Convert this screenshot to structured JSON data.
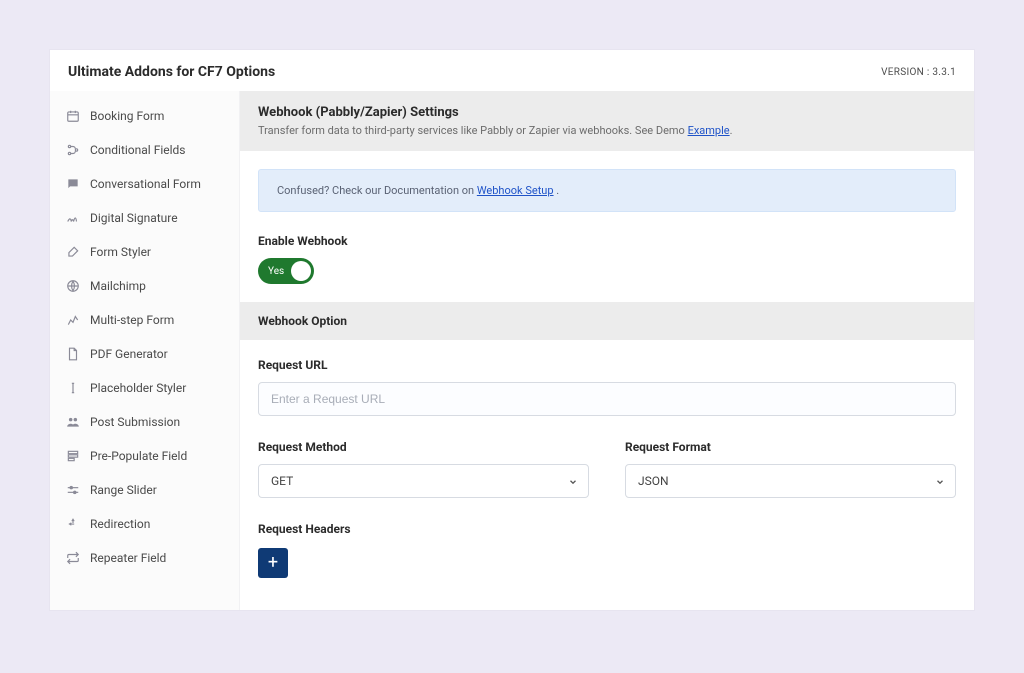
{
  "header": {
    "title": "Ultimate Addons for CF7 Options",
    "version": "VERSION : 3.3.1"
  },
  "sidebar": {
    "items": [
      {
        "label": "Booking Form",
        "icon": "calendar-icon"
      },
      {
        "label": "Conditional Fields",
        "icon": "branch-icon"
      },
      {
        "label": "Conversational Form",
        "icon": "chat-icon"
      },
      {
        "label": "Digital Signature",
        "icon": "signature-icon"
      },
      {
        "label": "Form Styler",
        "icon": "brush-icon"
      },
      {
        "label": "Mailchimp",
        "icon": "mail-icon"
      },
      {
        "label": "Multi-step Form",
        "icon": "steps-icon"
      },
      {
        "label": "PDF Generator",
        "icon": "file-icon"
      },
      {
        "label": "Placeholder Styler",
        "icon": "cursor-icon"
      },
      {
        "label": "Post Submission",
        "icon": "users-icon"
      },
      {
        "label": "Pre-Populate Field",
        "icon": "populate-icon"
      },
      {
        "label": "Range Slider",
        "icon": "sliders-icon"
      },
      {
        "label": "Redirection",
        "icon": "redirect-icon"
      },
      {
        "label": "Repeater Field",
        "icon": "repeat-icon"
      }
    ]
  },
  "settings": {
    "title": "Webhook (Pabbly/Zapier) Settings",
    "subtitle_prefix": "Transfer form data to third-party services like Pabbly or Zapier via webhooks. See Demo ",
    "subtitle_link": "Example",
    "info_prefix": "Confused? Check our Documentation on ",
    "info_link": "Webhook Setup",
    "enable_label": "Enable Webhook",
    "toggle_value": "Yes",
    "option_section": "Webhook Option",
    "request_url_label": "Request URL",
    "request_url_placeholder": "Enter a Request URL",
    "request_url_value": "",
    "request_method_label": "Request Method",
    "request_method_value": "GET",
    "request_format_label": "Request Format",
    "request_format_value": "JSON",
    "request_headers_label": "Request Headers"
  }
}
